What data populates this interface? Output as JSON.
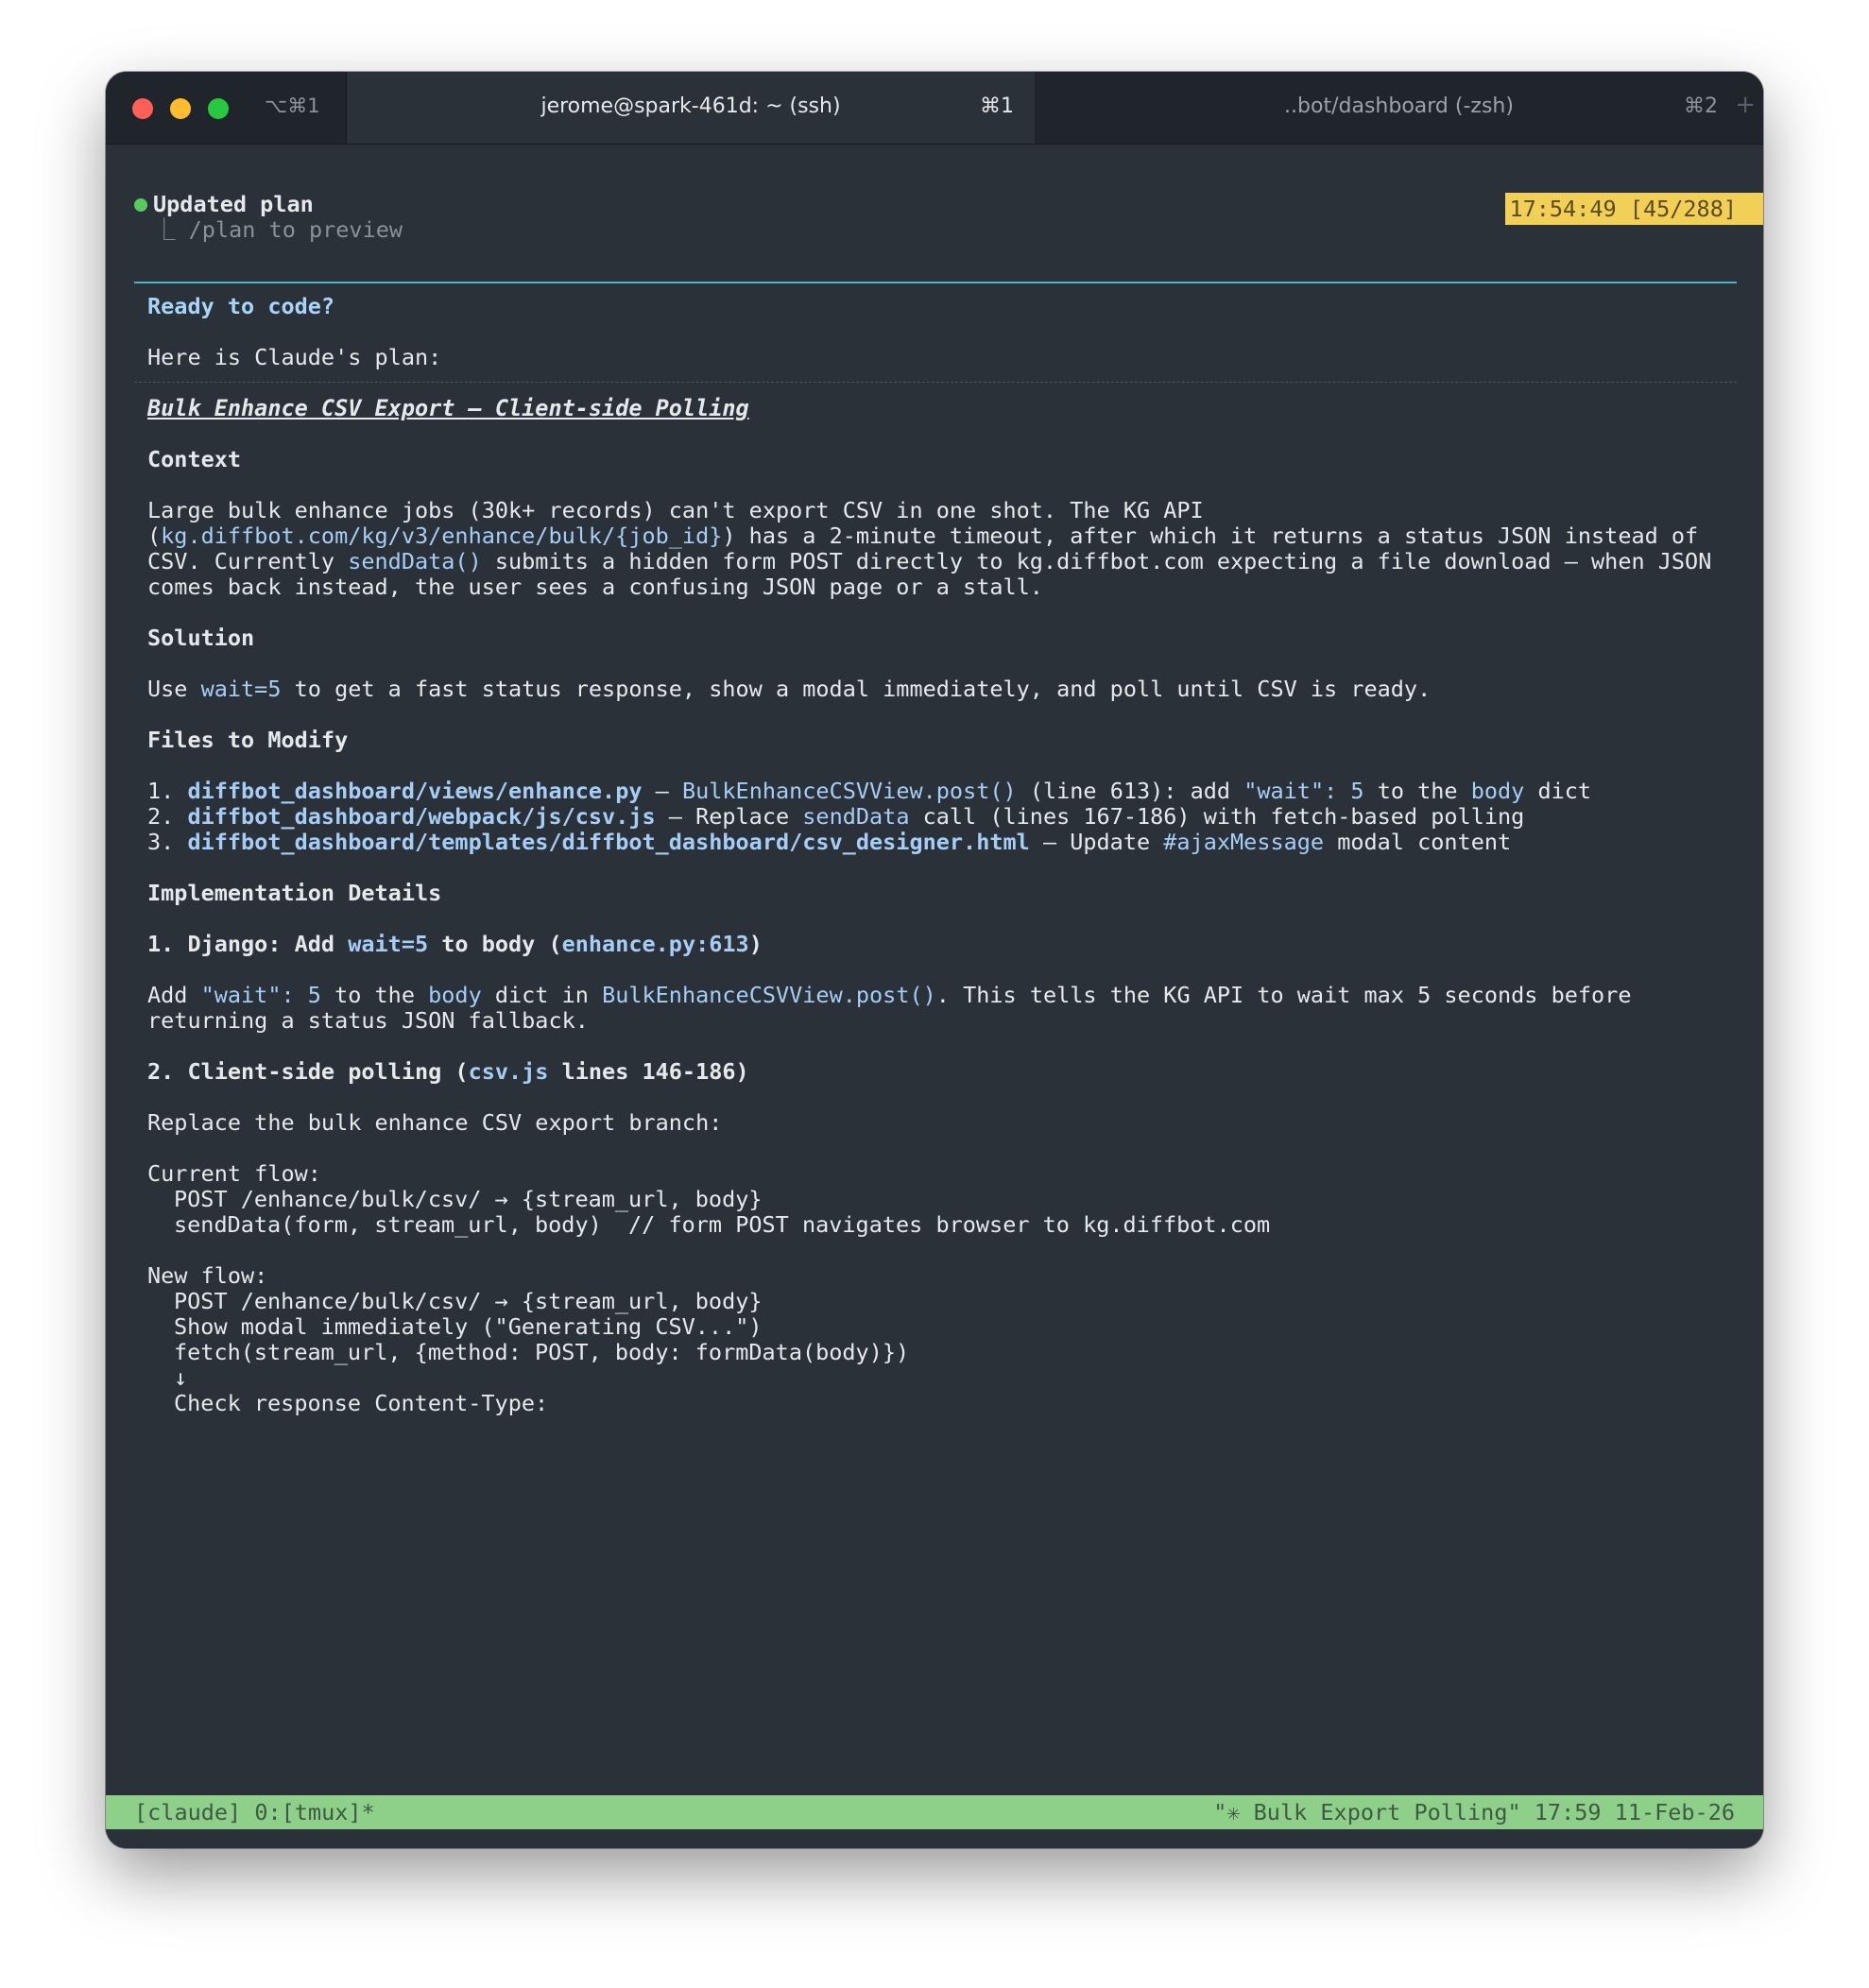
{
  "window": {
    "shortcut": "⌥⌘1",
    "tabs": [
      {
        "title": "jerome@spark-461d: ~ (ssh)",
        "key": "⌘1"
      },
      {
        "title": "..bot/dashboard (-zsh)",
        "key": "⌘2"
      }
    ],
    "new_tab": "+"
  },
  "header": {
    "status": "Updated plan",
    "sub_prefix": "⎿ ",
    "sub": "/plan to preview",
    "clock_badge": "17:54:49 [45/288]"
  },
  "plan": {
    "prompt": "Ready to code?",
    "intro": "Here is Claude's plan:",
    "title_a": "Bulk Enhance CSV Export ",
    "title_b": "— Client-side Polling",
    "context_heading": "Context",
    "context": {
      "l1": "Large bulk enhance jobs (30k+ records) can't export CSV in one shot. The KG API",
      "l2_a": "(",
      "l2_code": "kg.diffbot.com/kg/v3/enhance/bulk/{job_id}",
      "l2_b": ") has a 2-minute timeout, after which it returns a status JSON instead of",
      "l3_a": "CSV. Currently ",
      "l3_code": "sendData()",
      "l3_b": " submits a hidden form POST directly to kg.diffbot.com expecting a file download — when JSON",
      "l4": "comes back instead, the user sees a confusing JSON page or a stall."
    },
    "solution_heading": "Solution",
    "solution": {
      "a": "Use ",
      "code": "wait=5",
      "b": " to get a fast status response, show a modal immediately, and poll until CSV is ready."
    },
    "files_heading": "Files to Modify",
    "files": [
      {
        "num": "1. ",
        "path": "diffbot_dashboard/views/enhance.py",
        "t1": " — ",
        "c1": "BulkEnhanceCSVView.post()",
        "t2": " (line 613): add ",
        "c2": "\"wait\": 5",
        "t3": " to the ",
        "c3": "body",
        "t4": " dict"
      },
      {
        "num": "2. ",
        "path": "diffbot_dashboard/webpack/js/csv.js",
        "t1": " — Replace ",
        "c1": "sendData",
        "t2": " call (lines 167-186) with fetch-based polling"
      },
      {
        "num": "3. ",
        "path": "diffbot_dashboard/templates/diffbot_dashboard/csv_designer.html",
        "t1": " — Update ",
        "c1": "#ajaxMessage",
        "t2": " modal content"
      }
    ],
    "impl_heading": "Implementation Details",
    "step1": {
      "a": "1. Django: Add ",
      "code1": "wait=5",
      "b": " to body (",
      "code2": "enhance.py:613",
      "c": ")",
      "text_a": "Add ",
      "text_code1": "\"wait\": 5",
      "text_b": " to the ",
      "text_code2": "body",
      "text_c": " dict in ",
      "text_code3": "BulkEnhanceCSVView.post()",
      "text_d": ". This tells the KG API to wait max 5 seconds before",
      "text_l2": "returning a status JSON fallback."
    },
    "step2": {
      "a": "2. Client-side polling (",
      "code": "csv.js",
      "b": " lines 146-186)",
      "text": "Replace the bulk enhance CSV export branch:"
    },
    "current_flow": {
      "label": "Current flow:",
      "lines": [
        "POST /enhance/bulk/csv/ → {stream_url, body}",
        "sendData(form, stream_url, body)  // form POST navigates browser to kg.diffbot.com"
      ]
    },
    "new_flow": {
      "label": "New flow:",
      "lines": [
        "POST /enhance/bulk/csv/ → {stream_url, body}",
        "Show modal immediately (\"Generating CSV...\")",
        "fetch(stream_url, {method: POST, body: formData(body)})",
        "↓",
        "Check response Content-Type:"
      ]
    }
  },
  "tmux": {
    "left": "[claude] 0:[tmux]*",
    "right": "\"✳ Bulk Export Polling\" 17:59 11-Feb-26"
  },
  "colors": {
    "accent_cyan": "#49b5c1",
    "code_blue": "#a6cdf5",
    "badge_yellow": "#f2cf56",
    "tmux_green": "#8ed08a",
    "status_green": "#58c95f"
  }
}
